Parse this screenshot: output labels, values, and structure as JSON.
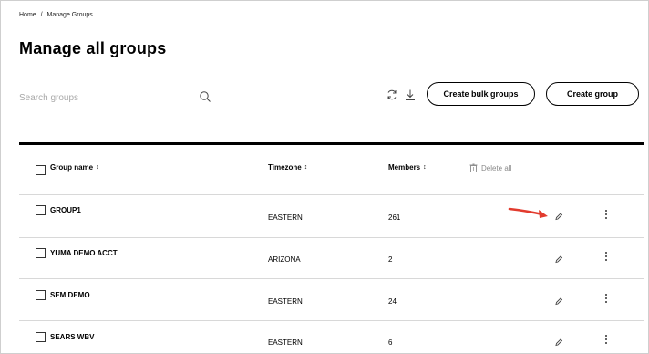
{
  "breadcrumb": {
    "home": "Home",
    "separator": "/",
    "current": "Manage Groups"
  },
  "page": {
    "title": "Manage all groups"
  },
  "search": {
    "placeholder": "Search groups"
  },
  "toolbar": {
    "refresh_icon": "refresh-icon",
    "download_icon": "download-icon",
    "create_bulk_label": "Create bulk groups",
    "create_group_label": "Create group"
  },
  "table": {
    "columns": {
      "name": "Group name",
      "timezone": "Timezone",
      "members": "Members",
      "sort_glyph": "↕"
    },
    "delete_all_label": "Delete all",
    "rows": [
      {
        "name": "GROUP1",
        "timezone": "EASTERN",
        "members": "261"
      },
      {
        "name": "YUMA DEMO ACCT",
        "timezone": "ARIZONA",
        "members": "2"
      },
      {
        "name": "SEM DEMO",
        "timezone": "EASTERN",
        "members": "24"
      },
      {
        "name": "SEARS WBV",
        "timezone": "EASTERN",
        "members": "6"
      }
    ]
  },
  "annotation": {
    "arrow_color": "#e23b2e"
  }
}
